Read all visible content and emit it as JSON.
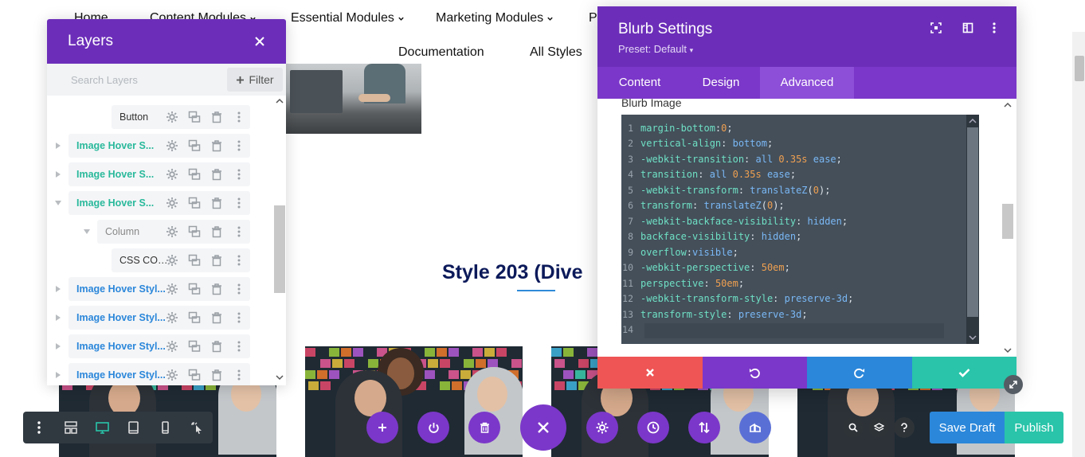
{
  "nav": {
    "items": [
      {
        "label": "Home",
        "has_dropdown": false
      },
      {
        "label": "Content Modules",
        "has_dropdown": true
      },
      {
        "label": "Essential Modules",
        "has_dropdown": true
      },
      {
        "label": "Marketing Modules",
        "has_dropdown": true
      },
      {
        "label": "Pr",
        "has_dropdown": false
      },
      {
        "label": "Documentation",
        "has_dropdown": false
      },
      {
        "label": "All Styles",
        "has_dropdown": false
      }
    ]
  },
  "section": {
    "title": "Style 203 (Dive"
  },
  "layers": {
    "title": "Layers",
    "search_placeholder": "Search Layers",
    "filter_label": "Filter",
    "items": [
      {
        "label": "Button",
        "style": "dark",
        "arrow": "none"
      },
      {
        "label": "Image Hover S...",
        "style": "teal",
        "arrow": "right"
      },
      {
        "label": "Image Hover S...",
        "style": "teal",
        "arrow": "right"
      },
      {
        "label": "Image Hover S...",
        "style": "teal",
        "arrow": "down"
      },
      {
        "label": "Column",
        "style": "gray",
        "arrow": "down"
      },
      {
        "label": "CSS CODE",
        "style": "dark",
        "arrow": "none"
      },
      {
        "label": "Image Hover Styl...",
        "style": "blue",
        "arrow": "right"
      },
      {
        "label": "Image Hover Styl...",
        "style": "blue",
        "arrow": "right"
      },
      {
        "label": "Image Hover Styl...",
        "style": "blue",
        "arrow": "right"
      },
      {
        "label": "Image Hover Styl...",
        "style": "blue",
        "arrow": "right"
      }
    ]
  },
  "blurb_settings": {
    "title": "Blurb Settings",
    "preset": "Preset: Default",
    "tabs": [
      {
        "label": "Content",
        "active": false
      },
      {
        "label": "Design",
        "active": false
      },
      {
        "label": "Advanced",
        "active": true
      }
    ],
    "section_label": "Blurb Image",
    "code_lines": [
      [
        {
          "t": "prop",
          "s": "margin-bottom"
        },
        {
          "t": "punc",
          "s": ":"
        },
        {
          "t": "num",
          "s": "0"
        },
        {
          "t": "punc",
          "s": ";"
        }
      ],
      [
        {
          "t": "prop",
          "s": "vertical-align"
        },
        {
          "t": "punc",
          "s": ": "
        },
        {
          "t": "val",
          "s": "bottom"
        },
        {
          "t": "punc",
          "s": ";"
        }
      ],
      [
        {
          "t": "prop",
          "s": "-webkit-transition"
        },
        {
          "t": "punc",
          "s": ": "
        },
        {
          "t": "val",
          "s": "all "
        },
        {
          "t": "num",
          "s": "0.35s"
        },
        {
          "t": "val",
          "s": " ease"
        },
        {
          "t": "punc",
          "s": ";"
        }
      ],
      [
        {
          "t": "prop",
          "s": "transition"
        },
        {
          "t": "punc",
          "s": ": "
        },
        {
          "t": "val",
          "s": "all "
        },
        {
          "t": "num",
          "s": "0.35s"
        },
        {
          "t": "val",
          "s": " ease"
        },
        {
          "t": "punc",
          "s": ";"
        }
      ],
      [
        {
          "t": "prop",
          "s": "-webkit-transform"
        },
        {
          "t": "punc",
          "s": ": "
        },
        {
          "t": "val",
          "s": "translateZ"
        },
        {
          "t": "punc",
          "s": "("
        },
        {
          "t": "num",
          "s": "0"
        },
        {
          "t": "punc",
          "s": ");"
        }
      ],
      [
        {
          "t": "prop",
          "s": "transform"
        },
        {
          "t": "punc",
          "s": ": "
        },
        {
          "t": "val",
          "s": "translateZ"
        },
        {
          "t": "punc",
          "s": "("
        },
        {
          "t": "num",
          "s": "0"
        },
        {
          "t": "punc",
          "s": ");"
        }
      ],
      [
        {
          "t": "prop",
          "s": "-webkit-backface-visibility"
        },
        {
          "t": "punc",
          "s": ": "
        },
        {
          "t": "val",
          "s": "hidden"
        },
        {
          "t": "punc",
          "s": ";"
        }
      ],
      [
        {
          "t": "prop",
          "s": "backface-visibility"
        },
        {
          "t": "punc",
          "s": ": "
        },
        {
          "t": "val",
          "s": "hidden"
        },
        {
          "t": "punc",
          "s": ";"
        }
      ],
      [
        {
          "t": "prop",
          "s": "overflow"
        },
        {
          "t": "punc",
          "s": ":"
        },
        {
          "t": "val",
          "s": "visible"
        },
        {
          "t": "punc",
          "s": ";"
        }
      ],
      [
        {
          "t": "prop",
          "s": "-webkit-perspective"
        },
        {
          "t": "punc",
          "s": ": "
        },
        {
          "t": "num",
          "s": "50em"
        },
        {
          "t": "punc",
          "s": ";"
        }
      ],
      [
        {
          "t": "prop",
          "s": "perspective"
        },
        {
          "t": "punc",
          "s": ": "
        },
        {
          "t": "num",
          "s": "50em"
        },
        {
          "t": "punc",
          "s": ";"
        }
      ],
      [
        {
          "t": "prop",
          "s": "-webkit-transform-style"
        },
        {
          "t": "punc",
          "s": ": "
        },
        {
          "t": "val",
          "s": "preserve-3d"
        },
        {
          "t": "punc",
          "s": ";"
        }
      ],
      [
        {
          "t": "prop",
          "s": "transform-style"
        },
        {
          "t": "punc",
          "s": ": "
        },
        {
          "t": "val",
          "s": "preserve-3d"
        },
        {
          "t": "punc",
          "s": ";"
        }
      ],
      []
    ]
  },
  "footer_buttons": [
    {
      "name": "discard",
      "icon": "close-icon",
      "color": "#ef5555"
    },
    {
      "name": "undo",
      "icon": "undo-icon",
      "color": "#7b37c9"
    },
    {
      "name": "redo",
      "icon": "redo-icon",
      "color": "#2b87da"
    },
    {
      "name": "save",
      "icon": "check-icon",
      "color": "#29c4a9"
    }
  ],
  "bottom_bar": {
    "save_draft": "Save Draft",
    "publish": "Publish"
  },
  "colors": {
    "purple": "#6c2eb9",
    "teal": "#29c4a9",
    "blue": "#2b87da",
    "red": "#ef5555",
    "title_navy": "#0c1a5a"
  }
}
